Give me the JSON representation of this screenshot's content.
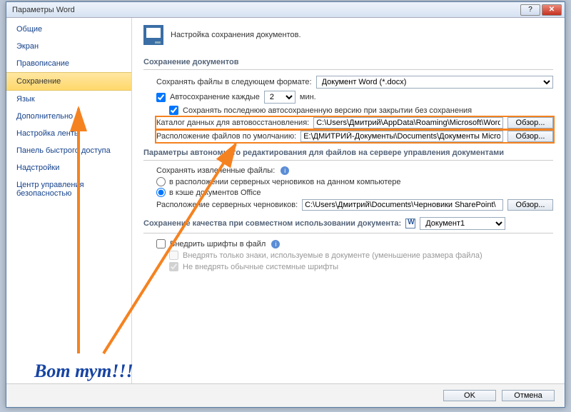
{
  "title": "Параметры Word",
  "header_text": "Настройка сохранения документов.",
  "sidebar": {
    "items": [
      {
        "label": "Общие"
      },
      {
        "label": "Экран"
      },
      {
        "label": "Правописание"
      },
      {
        "label": "Сохранение"
      },
      {
        "label": "Язык"
      },
      {
        "label": "Дополнительно"
      },
      {
        "label": "Настройка ленты"
      },
      {
        "label": "Панель быстрого доступа"
      },
      {
        "label": "Надстройки"
      },
      {
        "label": "Центр управления безопасностью"
      }
    ]
  },
  "sec_save_docs": "Сохранение документов",
  "save_format_lbl": "Сохранять файлы в следующем формате:",
  "save_format_val": "Документ Word (*.docx)",
  "autosave_lbl": "Автосохранение каждые",
  "autosave_val": "2",
  "autosave_unit": "мин.",
  "keep_last_lbl": "Сохранять последнюю автосохраненную версию при закрытии без сохранения",
  "autorecover_lbl": "Каталог данных для автовосстановления:",
  "autorecover_val": "C:\\Users\\Дмитрий\\AppData\\Roaming\\Microsoft\\Word\\",
  "default_loc_lbl": "Расположение файлов по умолчанию:",
  "default_loc_val": "E:\\ДМИТРИЙ-Документы\\Documents\\Документы Microsoft Word",
  "browse_btn": "Обзор...",
  "sec_server": "Параметры автономного редактирования для файлов на сервере управления документами",
  "save_checkedout_lbl": "Сохранять извлеченные файлы:",
  "radio1": "в расположении серверных черновиков на данном компьютере",
  "radio2": "в кэше документов Office",
  "drafts_lbl": "Расположение серверных черновиков:",
  "drafts_val": "C:\\Users\\Дмитрий\\Documents\\Черновики SharePoint\\",
  "sec_compat": "Сохранение качества при совместном использовании документа:",
  "compat_doc": "Документ1",
  "embed_fonts_lbl": "Внедрить шрифты в файл",
  "embed_only_used_lbl": "Внедрять только знаки, используемые в документе (уменьшение размера файла)",
  "no_sys_fonts_lbl": "Не внедрять обычные системные шрифты",
  "ok": "OK",
  "cancel": "Отмена",
  "annotation": "Вот тут!!!"
}
